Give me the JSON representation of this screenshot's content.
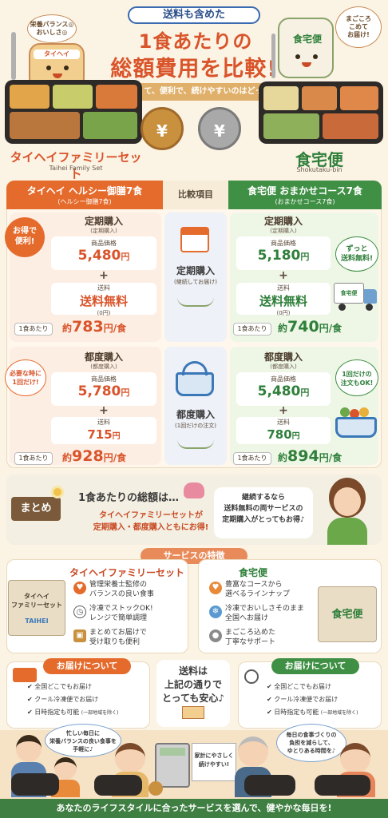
{
  "header": {
    "top_label": "送料も含めた",
    "title_line1": "1食あたりの",
    "title_line2": "総額費用を比較!",
    "subtitle": "おいしくて、便利で、続けやすいのはどっち?"
  },
  "mascots": {
    "left_bubble": "栄養バランス◎\nおいしさ◎",
    "left_headband": "タイヘイ",
    "right_bubble": "まごころ\nこめて\nお届け!",
    "right_box": "食宅便"
  },
  "brands": {
    "left_name": "タイヘイファミリーセット",
    "left_en": "Taihei Family Set",
    "right_name": "食宅便",
    "right_en": "Shokutaku-bin"
  },
  "coins": {
    "symbol": "¥"
  },
  "table": {
    "left_header": "タイヘイ ヘルシー御膳7食",
    "left_header_sub": "(ヘルシー御膳7食)",
    "mid_header": "比較項目",
    "right_header": "食宅便 おまかせコース7食",
    "right_header_sub": "(おまかせコース7食)",
    "left_badge": "お得で\n便利!",
    "right_badge_top": "ずっと\n送料無料!",
    "left_badge2": "必要な時に\n1回だけ!",
    "right_badge2": "1回だけの\n注文もOK!",
    "truck_label": "食宅便",
    "regular": {
      "mid_title": "定期購入",
      "mid_sub": "(継続してお届け)",
      "left": {
        "title": "定期購入",
        "title_sub": "(定期購入)",
        "price_label": "商品価格",
        "price": "5,480",
        "yen": "円",
        "shipping_label": "送料",
        "shipping": "送料無料",
        "shipping_sub": "(0円)",
        "per_label": "1食あたり",
        "per_prefix": "約",
        "per_value": "783",
        "per_suffix": "円/食"
      },
      "right": {
        "title": "定期購入",
        "title_sub": "(定期購入)",
        "price_label": "商品価格",
        "price": "5,180",
        "yen": "円",
        "shipping_label": "送料",
        "shipping": "送料無料",
        "shipping_sub": "(0円)",
        "per_label": "1食あたり",
        "per_prefix": "約",
        "per_value": "740",
        "per_suffix": "円/食"
      }
    },
    "single": {
      "mid_title": "都度購入",
      "mid_sub": "(1回だけの注文)",
      "left": {
        "title": "都度購入",
        "title_sub": "(都度購入)",
        "price_label": "商品価格",
        "price": "5,780",
        "yen": "円",
        "shipping_label": "送料",
        "shipping": "715",
        "shipping_yen": "円",
        "per_label": "1食あたり",
        "per_prefix": "約",
        "per_value": "928",
        "per_suffix": "円/食"
      },
      "right": {
        "title": "都度購入",
        "title_sub": "(都度購入)",
        "price_label": "商品価格",
        "price": "5,480",
        "yen": "円",
        "shipping_label": "送料",
        "shipping": "780",
        "shipping_yen": "円",
        "per_label": "1食あたり",
        "per_prefix": "約",
        "per_value": "894",
        "per_suffix": "円/食"
      }
    }
  },
  "summary": {
    "tag": "まとめ",
    "line1": "1食あたりの総額は…",
    "line2": "タイヘイファミリーセットが\n定期購入・都度購入ともにお得!",
    "bubble": "継続するなら\n送料無料の両サービスの\n定期購入がとってもお得♪"
  },
  "features": {
    "header": "サービスの特徴",
    "left_title": "タイヘイファミリーセット",
    "left_items": [
      "管理栄養士監修の\nバランスの良い食事",
      "冷凍でストックOK!\nレンジで簡単調理",
      "まとめてお届けで\n受け取りも便利"
    ],
    "left_box_label": "タイヘイ\nファミリーセット",
    "left_box_brand": "TAIHEI",
    "right_title": "食宅便",
    "right_items": [
      "豊富なコースから\n選べるラインナップ",
      "冷凍でおいしさそのまま\n全国へお届け",
      "まごころ込めた\n丁寧なサポート"
    ],
    "right_box_label": "食宅便"
  },
  "delivery": {
    "left_header": "お届けについて",
    "right_header": "お届けについて",
    "items": [
      "全国どこでもお届け",
      "クール冷凍便でお届け",
      "日時指定も可能"
    ],
    "note": "(一部地域を除く)",
    "mid": "送料は\n上記の通りで\nとっても安心♪"
  },
  "bottom": {
    "left_bubble": "忙しい毎日に\n栄養バランスの良い食事を\n手軽に♪",
    "right_bubble": "毎日の食事づくりの\n負担を減らして、\nゆとりある時間を♪",
    "notebook": "家計にやさしく\n続けやすい!",
    "banner": "あなたのライフスタイルに合ったサービスを選んで、健やかな毎日を!"
  }
}
